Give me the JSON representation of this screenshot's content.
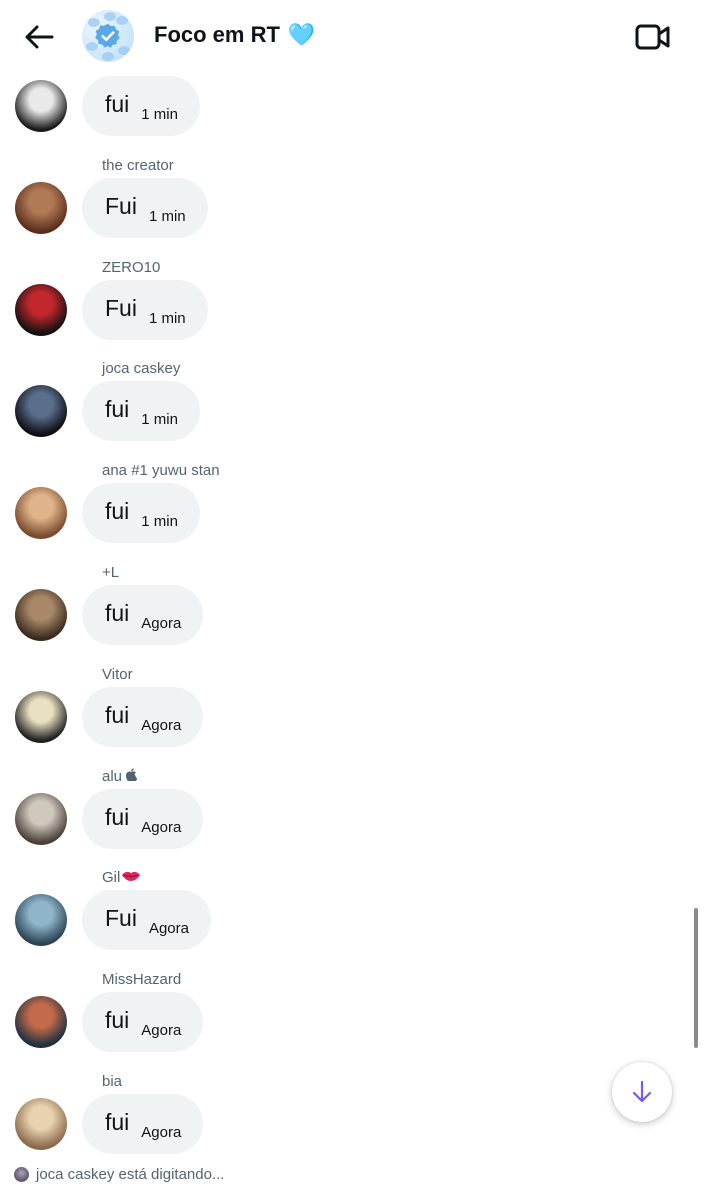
{
  "header": {
    "title": "Foco em RT",
    "title_emoji": "🩵",
    "back_icon": "arrow-left-icon",
    "video_icon": "video-camera-icon",
    "group_avatar_icon": "verified-badge-icon"
  },
  "messages": [
    {
      "sender": "",
      "text": "fui",
      "time": "1 min",
      "avatar_colors": [
        "#e9e9e9",
        "#1a1a1a"
      ]
    },
    {
      "sender": "the creator",
      "text": "Fui",
      "time": "1 min",
      "avatar_colors": [
        "#b07a55",
        "#5b2e1c"
      ]
    },
    {
      "sender": "ZERO10",
      "text": "Fui",
      "time": "1 min",
      "avatar_colors": [
        "#c1272d",
        "#111111"
      ]
    },
    {
      "sender": "joca caskey",
      "text": "fui",
      "time": "1 min",
      "avatar_colors": [
        "#5a6f8c",
        "#0d0d14"
      ]
    },
    {
      "sender": "ana #1 yuwu stan",
      "text": "fui",
      "time": "1 min",
      "avatar_colors": [
        "#e0b48a",
        "#7a4a2c"
      ]
    },
    {
      "sender": "+L",
      "text": "fui",
      "time": "Agora",
      "avatar_colors": [
        "#a88868",
        "#3b2a1e"
      ]
    },
    {
      "sender": "Vitor",
      "text": "fui",
      "time": "Agora",
      "avatar_colors": [
        "#e8e0c0",
        "#202020"
      ]
    },
    {
      "sender": "alu ",
      "text": "fui",
      "time": "Agora",
      "avatar_colors": [
        "#cfc8bd",
        "#4a4038"
      ]
    },
    {
      "sender": "Gil",
      "text": "Fui",
      "time": "Agora",
      "avatar_colors": [
        "#8fb5c9",
        "#2a4454"
      ]
    },
    {
      "sender": "MissHazard",
      "text": "fui",
      "time": "Agora",
      "avatar_colors": [
        "#c36a4a",
        "#1d3040"
      ]
    },
    {
      "sender": "bia",
      "text": "fui",
      "time": "Agora",
      "avatar_colors": [
        "#e8d2b0",
        "#8a6a4a"
      ]
    }
  ],
  "sender_suffix_icons": {
    "alu ": "apple-icon",
    "Gil": "lips-icon"
  },
  "typing_indicator": {
    "text": "joca caskey está digitando..."
  },
  "scroll_down_icon": "arrow-down-icon",
  "colors": {
    "bubble": "#eff3f4",
    "secondary_text": "#536471",
    "accent": "#7856ff"
  }
}
